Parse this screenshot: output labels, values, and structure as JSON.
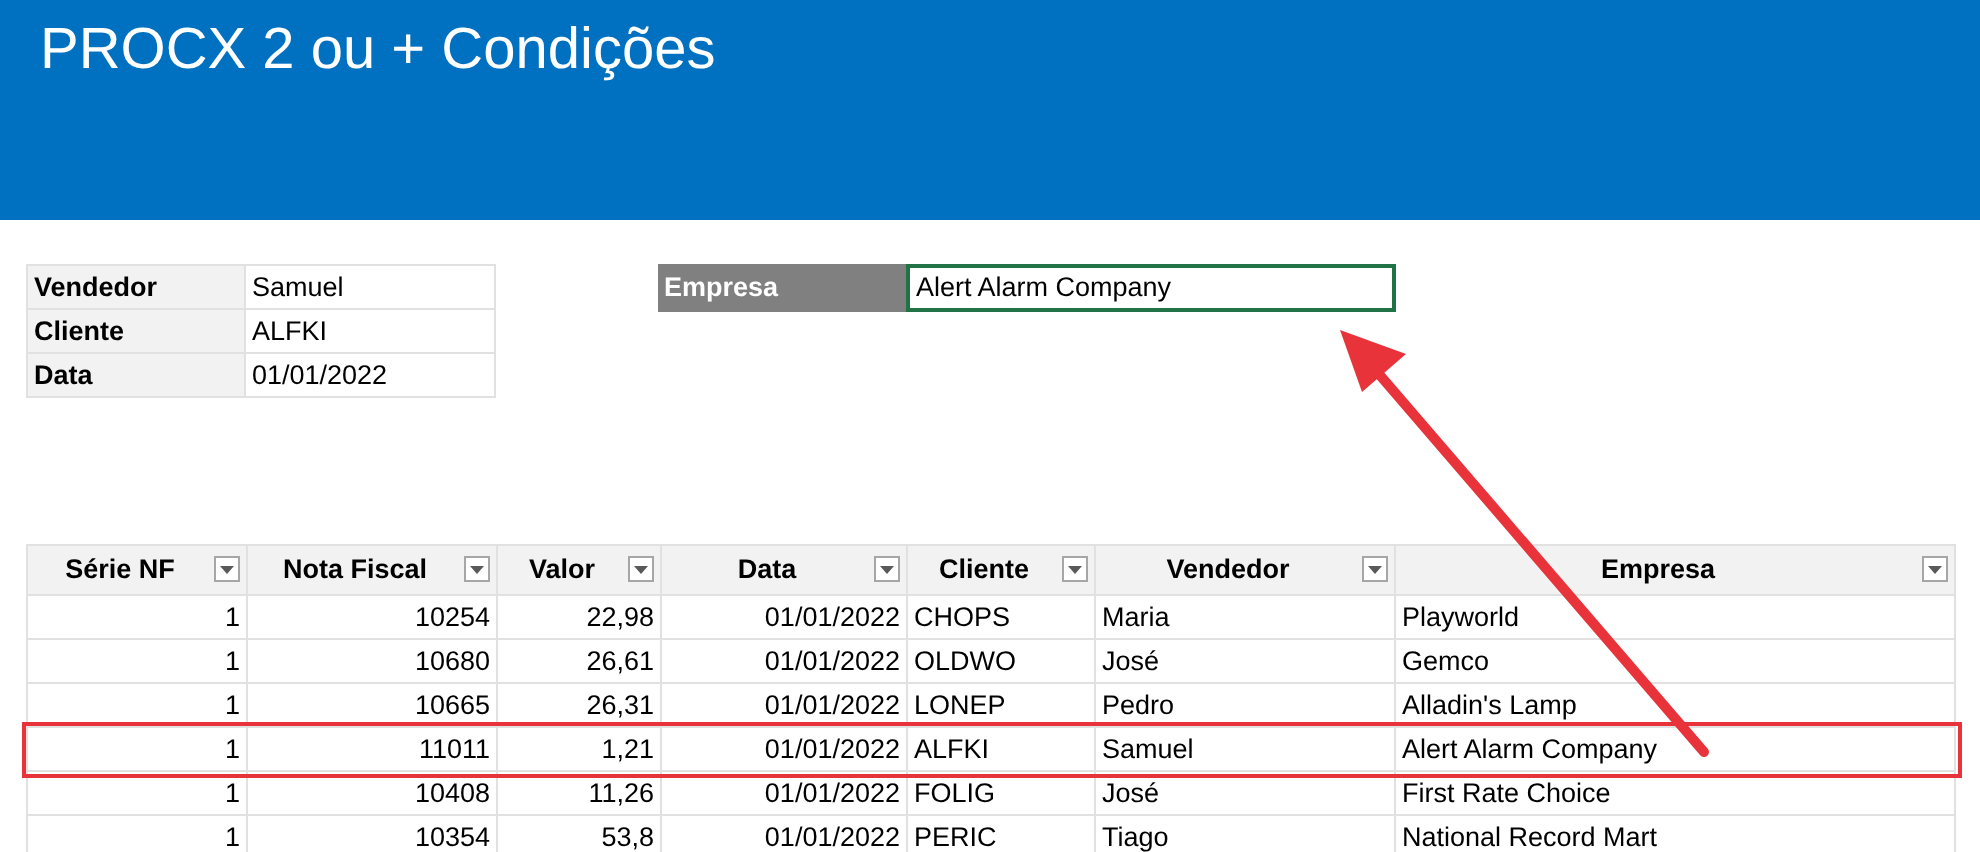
{
  "title": "PROCX 2 ou + Condições",
  "criteria": [
    {
      "label": "Vendedor",
      "value": "Samuel"
    },
    {
      "label": "Cliente",
      "value": "ALFKI"
    },
    {
      "label": "Data",
      "value": "01/01/2022"
    }
  ],
  "lookup": {
    "label": "Empresa",
    "value": "Alert Alarm Company",
    "selected": true
  },
  "table": {
    "columns": [
      {
        "label": "Série NF",
        "kind": "number"
      },
      {
        "label": "Nota Fiscal",
        "kind": "number"
      },
      {
        "label": "Valor",
        "kind": "number"
      },
      {
        "label": "Data",
        "kind": "number"
      },
      {
        "label": "Cliente",
        "kind": "text"
      },
      {
        "label": "Vendedor",
        "kind": "text"
      },
      {
        "label": "Empresa",
        "kind": "text"
      }
    ],
    "rows": [
      {
        "cells": [
          "1",
          "10254",
          "22,98",
          "01/01/2022",
          "CHOPS",
          "Maria",
          "Playworld"
        ],
        "highlighted": false
      },
      {
        "cells": [
          "1",
          "10680",
          "26,61",
          "01/01/2022",
          "OLDWO",
          "José",
          "Gemco"
        ],
        "highlighted": false
      },
      {
        "cells": [
          "1",
          "10665",
          "26,31",
          "01/01/2022",
          "LONEP",
          "Pedro",
          "Alladin's Lamp"
        ],
        "highlighted": false
      },
      {
        "cells": [
          "1",
          "11011",
          "1,21",
          "01/01/2022",
          "ALFKI",
          "Samuel",
          "Alert Alarm Company"
        ],
        "highlighted": true
      },
      {
        "cells": [
          "1",
          "10408",
          "11,26",
          "01/01/2022",
          "FOLIG",
          "José",
          "First Rate Choice"
        ],
        "highlighted": false
      },
      {
        "cells": [
          "1",
          "10354",
          "53,8",
          "01/01/2022",
          "PERIC",
          "Tiago",
          "National Record Mart"
        ],
        "highlighted": false
      }
    ]
  }
}
